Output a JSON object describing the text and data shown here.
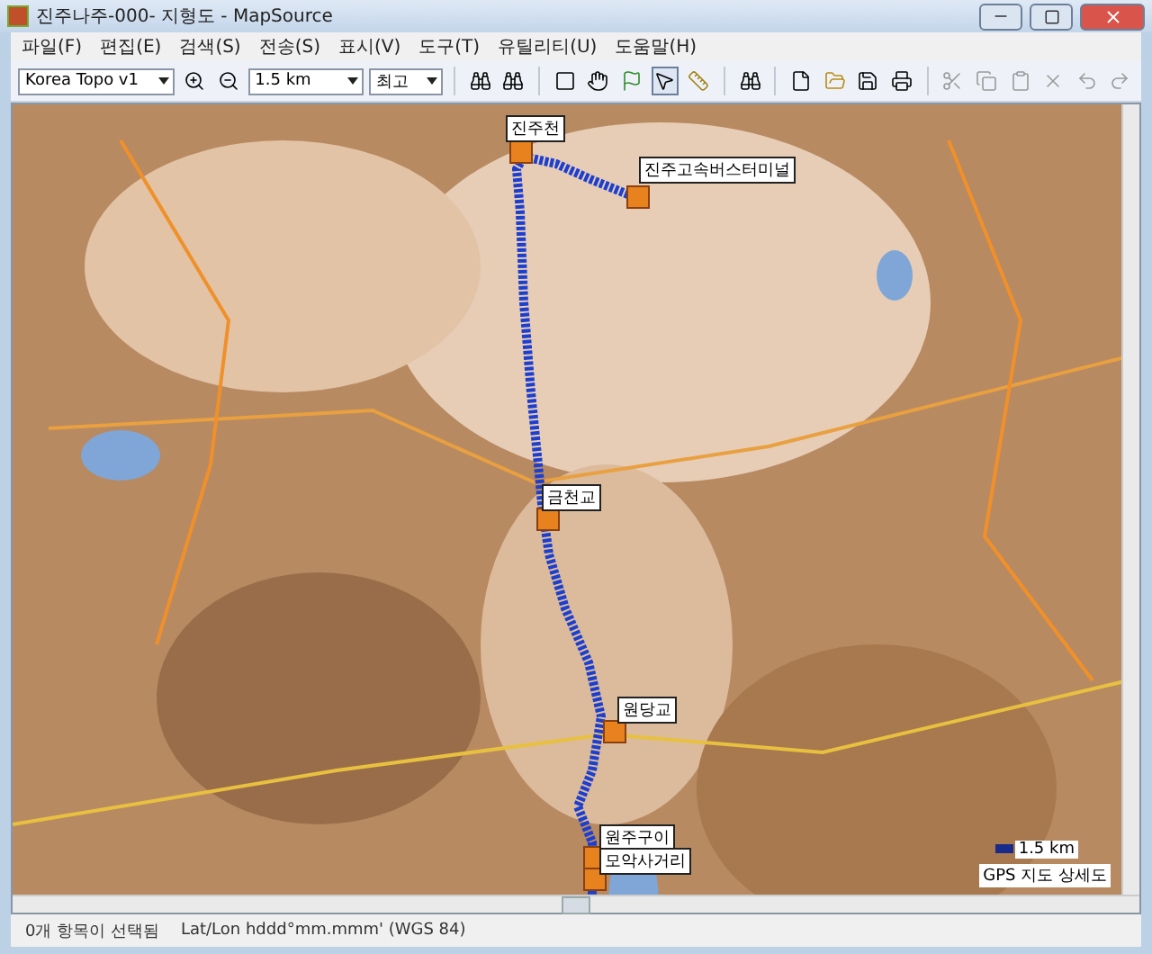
{
  "window": {
    "title": "진주나주-000- 지형도 - MapSource"
  },
  "menu": [
    "파일(F)",
    "편집(E)",
    "검색(S)",
    "전송(S)",
    "표시(V)",
    "도구(T)",
    "유틸리티(U)",
    "도움말(H)"
  ],
  "toolbar": {
    "map_product": "Korea Topo v1",
    "zoom": "1.5 km",
    "detail": "최고"
  },
  "map": {
    "waypoints": [
      {
        "label": "진주천"
      },
      {
        "label": "진주고속버스터미널"
      },
      {
        "label": "금천교"
      },
      {
        "label": "원당교"
      },
      {
        "label": "원주구이"
      },
      {
        "label": "모악사거리"
      }
    ],
    "scale": "1.5 km",
    "detail_label": "GPS 지도 상세도"
  },
  "status_bar": {
    "selection": "0개 항목이 선택됨",
    "position_format": "Lat/Lon hddd°mm.mmm' (WGS 84)"
  }
}
